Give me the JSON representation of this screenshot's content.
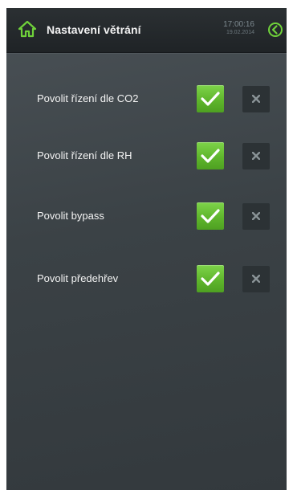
{
  "header": {
    "title": "Nastavení větrání",
    "time": "17:00:16",
    "date": "19.02.2014",
    "home_icon": "home-icon",
    "back_icon": "back-arrow-circle-icon"
  },
  "settings": [
    {
      "label": "Povolit řízení dle CO2",
      "enabled": true
    },
    {
      "label": "Povolit řízení dle RH",
      "enabled": true
    },
    {
      "label": "Povolit bypass",
      "enabled": true
    },
    {
      "label": "Povolit předehřev",
      "enabled": true
    }
  ],
  "colors": {
    "accent_green": "#5fb62c",
    "header_bg": "#24282b",
    "panel_bg": "#3b4246",
    "text": "#f4f4f4"
  }
}
